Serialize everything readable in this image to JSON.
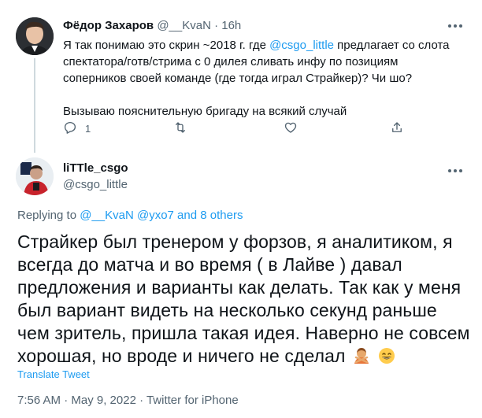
{
  "reply_tweet": {
    "author_name": "Фёдор Захаров",
    "author_handle": "@__KvaN",
    "separator": "·",
    "time": "16h",
    "text_part1": "Я так понимаю это скрин ~2018 г. где ",
    "mention": "@csgo_little",
    "text_part2": " предлагает со слота спектатора/готв/стрима с 0 дилея сливать инфу по позициям соперников своей команде (где тогда играл Страйкер)? Чи шо?",
    "text_line2": "Вызываю пояснительную бригаду на всякий случай",
    "reply_count": "1",
    "retweet_count": "",
    "like_count": ""
  },
  "main_tweet": {
    "author_name": "liTTle_csgo",
    "author_handle": "@csgo_little",
    "replying_prefix": "Replying to ",
    "replying_targets": "@__KvaN @yxo7 and 8 others",
    "text": "Страйкер был тренером у форзов, я аналитиком, я всегда до матча и во время ( в Лайве ) давал предложения и варианты как делать. Так как у меня был вариант видеть на несколько секунд раньше чем зритель, пришла такая идея. Наверно не совсем хорошая, но вроде и ничего не сделал",
    "emojis": [
      "person-gesturing-no-emoji",
      "grinning-face-emoji"
    ],
    "translate_label": "Translate Tweet",
    "timestamp": "7:56 AM · May 9, 2022 · Twitter for iPhone"
  },
  "icons": [
    "more-icon",
    "reply-icon",
    "retweet-icon",
    "like-icon",
    "share-icon"
  ],
  "colors": {
    "link": "#1d9bf0",
    "secondary": "#536471",
    "text": "#0f1419"
  }
}
